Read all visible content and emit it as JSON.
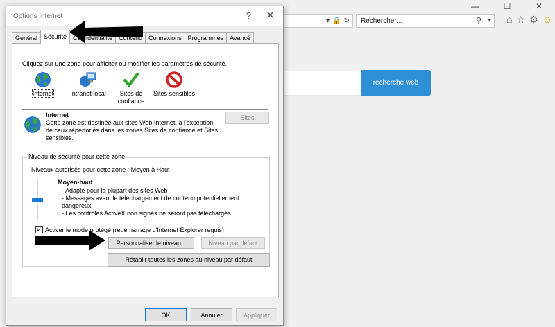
{
  "browser": {
    "search_placeholder": "Rechercher...",
    "web_search_label": "recherche web"
  },
  "dialog": {
    "title": "Options Internet",
    "help": "?",
    "close": "✕",
    "tabs": [
      "Général",
      "Sécurité",
      "Confidentialité",
      "Contenu",
      "Connexions",
      "Programmes",
      "Avancé"
    ],
    "active_tab": "Sécurité",
    "instruction": "Cliquez sur une zone pour afficher ou modifier les paramètres de sécurité.",
    "zones": [
      {
        "label": "Internet",
        "icon": "globe-icon"
      },
      {
        "label": "Intranet local",
        "icon": "intranet-icon"
      },
      {
        "label": "Sites de confiance",
        "icon": "checkmark-icon"
      },
      {
        "label": "Sites sensibles",
        "icon": "restricted-icon"
      }
    ],
    "zone_desc": {
      "title": "Internet",
      "text": "Cette zone est destinée aux sites Web Internet, à l'exception de ceux répertoriés dans les zones Sites de confiance et Sites sensibles."
    },
    "sites_button": "Sites",
    "security_group": {
      "legend": "Niveau de sécurité pour cette zone",
      "allowed": "Niveaux autorisés pour cette zone : Moyen à Haut",
      "level_title": "Moyen-haut",
      "level_lines": [
        "- Adapté pour la plupart des sites Web",
        "- Messages avant le téléchargement de contenu potentiellement dangereux",
        "- Les contrôles ActiveX non signés ne seront pas téléchargés."
      ],
      "protected_mode": "Activer le mode protégé (redémarrage d'Internet Explorer requis)",
      "protected_checked": true,
      "custom_button": "Personnaliser le niveau...",
      "default_button": "Niveau par défaut"
    },
    "reset_all_button": "Rétablir toutes les zones au niveau par défaut",
    "footer": {
      "ok": "OK",
      "cancel": "Annuler",
      "apply": "Appliquer"
    }
  },
  "colors": {
    "accent": "#2e8fd6",
    "slider_thumb": "#1777d4",
    "annotation_arrow": "#000000"
  }
}
